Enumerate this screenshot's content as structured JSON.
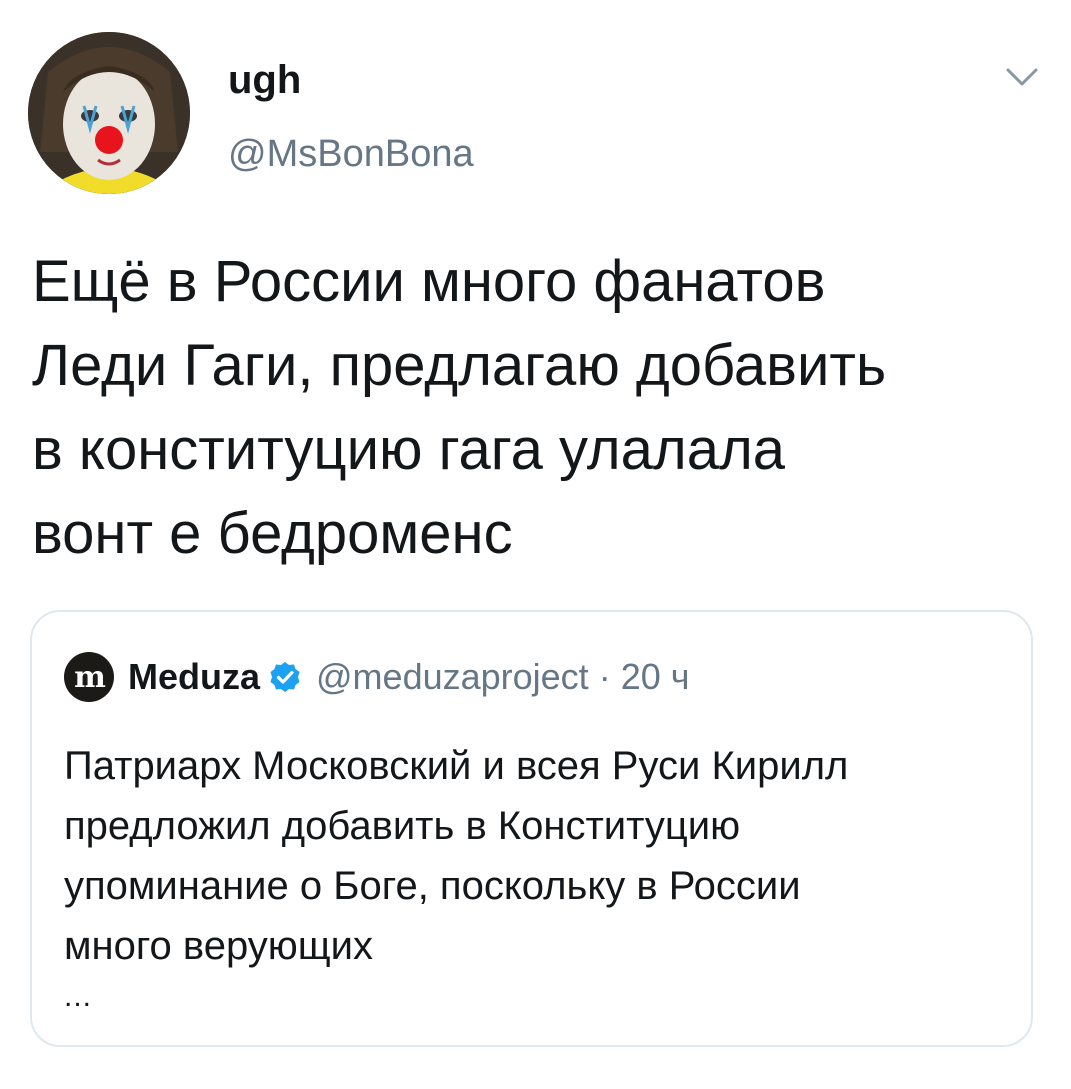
{
  "author": {
    "display_name": "ugh",
    "handle": "@MsBonBona",
    "avatar_icon": "clown-face-avatar"
  },
  "menu": {
    "icon": "chevron-down-icon"
  },
  "tweet": {
    "text": "Ещё в России много фанатов\nЛеди Гаги, предлагаю добавить\nв конституцию гага улалала\nвонт е бедроменс"
  },
  "quote": {
    "logo_text": "m",
    "name": "Meduza",
    "verified_icon": "verified-badge-icon",
    "handle": "@meduzaproject",
    "separator": "·",
    "time": "20 ч",
    "text": "Патриарх Московский и всея Руси Кирилл\nпредложил добавить в Конституцию\nупоминание о Боге, поскольку в России\nмного верующих",
    "ellipsis": "..."
  },
  "colors": {
    "text": "#14171a",
    "secondary": "#657786",
    "border": "#e1e8ed",
    "verified": "#1da1f2"
  }
}
